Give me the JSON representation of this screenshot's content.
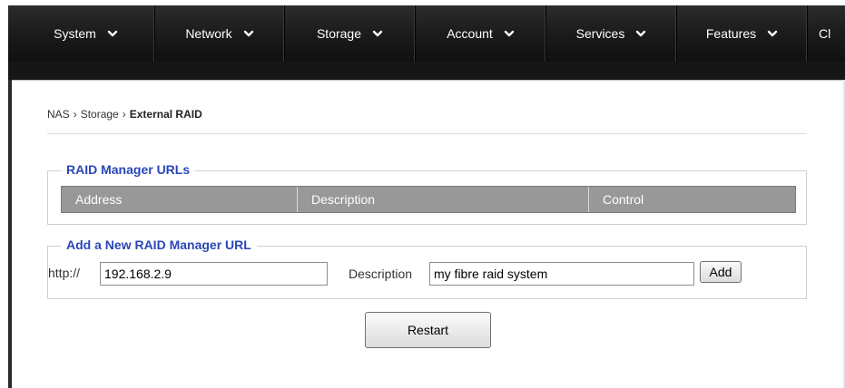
{
  "nav": {
    "items": [
      {
        "label": "System",
        "width": 162
      },
      {
        "label": "Network",
        "width": 143
      },
      {
        "label": "Storage",
        "width": 144
      },
      {
        "label": "Account",
        "width": 144
      },
      {
        "label": "Services",
        "width": 144
      },
      {
        "label": "Features",
        "width": 144
      },
      {
        "label": "Cl",
        "width": 60
      }
    ]
  },
  "breadcrumb": {
    "root": "NAS",
    "middle": "Storage",
    "current": "External RAID",
    "separator": "›"
  },
  "raid_urls": {
    "legend": "RAID Manager URLs",
    "columns": [
      "Address",
      "Description",
      "Control"
    ]
  },
  "add_url": {
    "legend": "Add a New RAID Manager URL",
    "prefix_label": "http://",
    "address_value": "192.168.2.9",
    "description_label": "Description",
    "description_value": "my fibre raid system",
    "add_button": "Add"
  },
  "restart_button": "Restart",
  "icons": {
    "dropdown": "chevron-down-icon"
  },
  "colors": {
    "legend": "#2b46b8",
    "table_header": "#989898",
    "navbar": "#1b1b1b"
  }
}
